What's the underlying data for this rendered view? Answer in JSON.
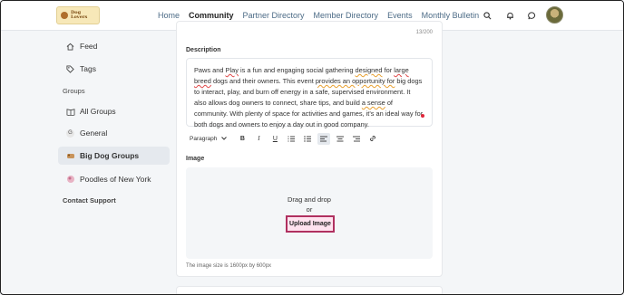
{
  "header": {
    "logo_text": "Dog Lovers",
    "nav": [
      "Home",
      "Community",
      "Partner Directory",
      "Member Directory",
      "Events",
      "Monthly Bulletin"
    ],
    "active_nav": "Community",
    "icons": [
      "search-icon",
      "bell-icon",
      "chat-icon"
    ]
  },
  "sidebar": {
    "feed": "Feed",
    "tags": "Tags",
    "groups_heading": "Groups",
    "all_groups": "All Groups",
    "general": "General",
    "general_badge": "G",
    "big_dog_groups": "Big Dog Groups",
    "poodles": "Poodles of New York",
    "contact_support": "Contact Support"
  },
  "form": {
    "char_counter": "13/200",
    "description_label": "Description",
    "description_parts": [
      "Paws and ",
      "Play",
      "  is a fun and engaging social gathering ",
      "designed",
      " for ",
      "large breed",
      " dogs and their owners. This event ",
      "provides an opportunity for",
      " big dogs to interact, play, and burn off energy in a safe, supervised environment. It also allows dog owners to connect, share tips, and build ",
      "a sense",
      " of community. With plenty of space for activities and games, it's an ideal way for both dogs and owners to enjoy a day out in good company."
    ],
    "toolbar": {
      "paragraph_label": "Paragraph",
      "bold": "B",
      "italic": "I",
      "underline": "U"
    },
    "image_label": "Image",
    "drag_drop": "Drag and drop",
    "or": "or",
    "upload_button": "Upload Image",
    "image_note": "The image size is 1600px by 600px"
  }
}
